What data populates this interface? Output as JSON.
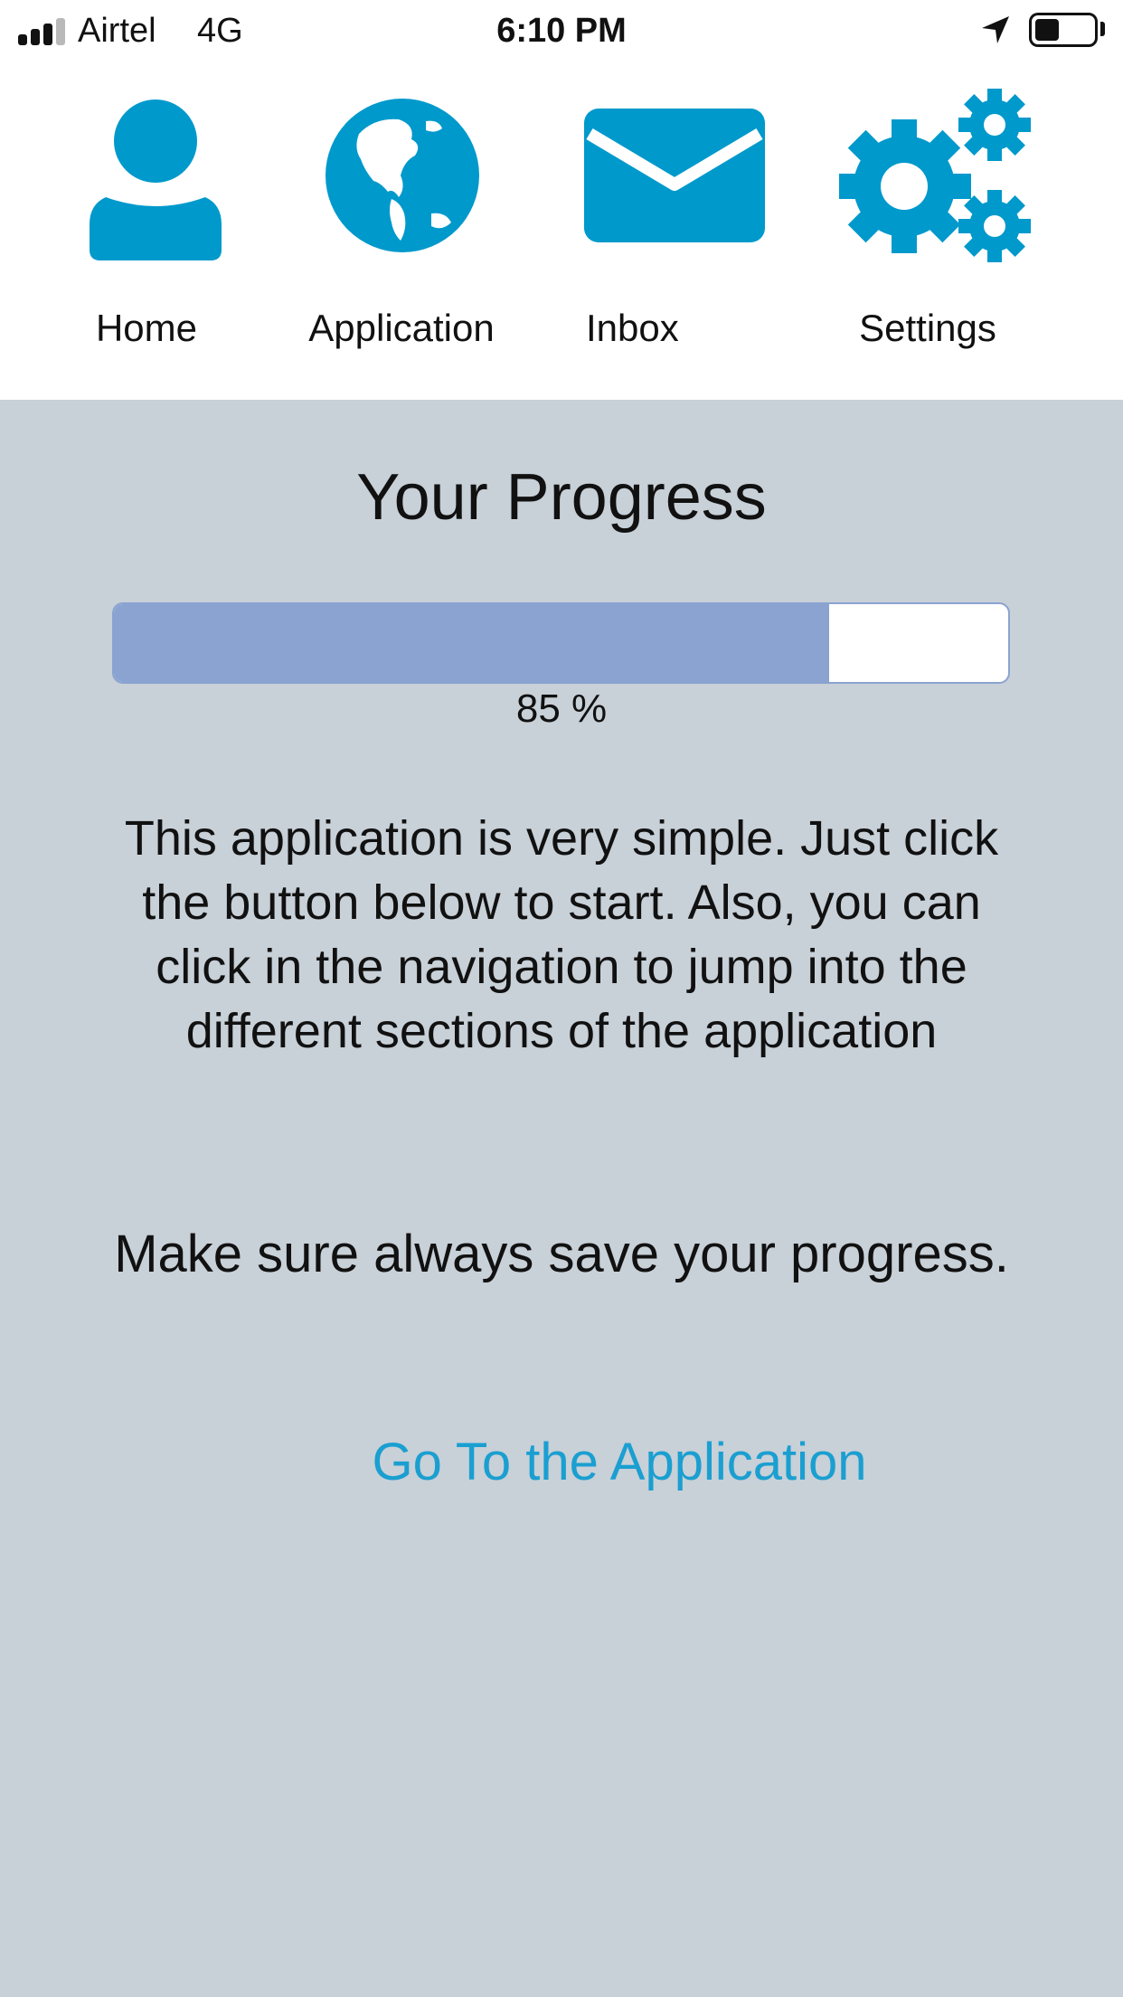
{
  "status_bar": {
    "carrier": "Airtel",
    "network": "4G",
    "time": "6:10 PM",
    "battery_percent": 40
  },
  "nav": {
    "accent_color": "#0099cc",
    "items": [
      {
        "label": "Home",
        "icon": "person-icon"
      },
      {
        "label": "Application",
        "icon": "globe-icon"
      },
      {
        "label": "Inbox",
        "icon": "envelope-icon"
      },
      {
        "label": "Settings",
        "icon": "gears-icon"
      }
    ]
  },
  "main": {
    "background": "#c8d0d8",
    "title": "Your Progress",
    "progress": {
      "value": 0.8,
      "label": "85 %",
      "fill_color": "#8aa3d0"
    },
    "description": "This application is very simple. Just click the button below to start. Also, you can click in the navigation to jump into the different sections of the application",
    "save_note": "Make sure always save your progress.",
    "cta_label": "Go To the Application",
    "cta_color": "#1a9fd0"
  }
}
